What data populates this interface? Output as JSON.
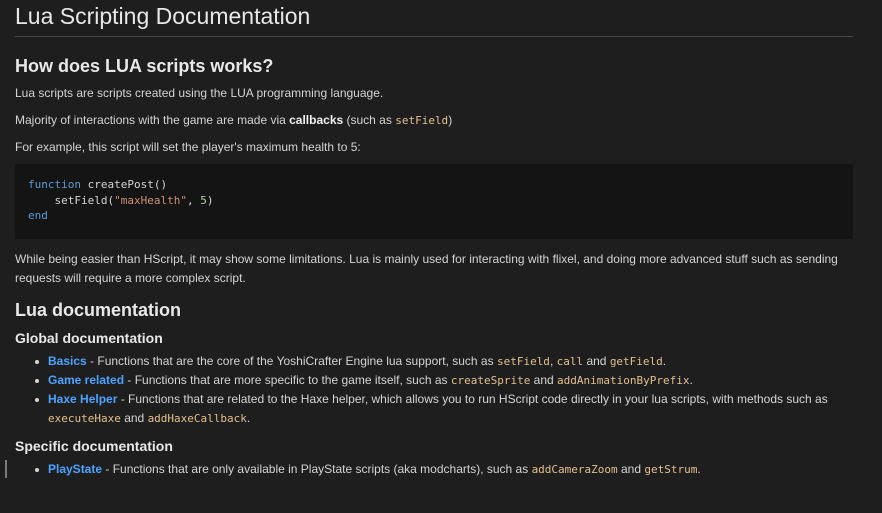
{
  "title": "Lua Scripting Documentation",
  "section1": {
    "heading": "How does LUA scripts works?",
    "p1": "Lua scripts are scripts created using the LUA programming language.",
    "p2_before": "Majority of interactions with the game are made via ",
    "p2_bold": "callbacks",
    "p2_mid": " (such as ",
    "p2_code": "setField",
    "p2_after": ")",
    "p3": "For example, this script will set the player's maximum health to 5:",
    "code": {
      "l1_kw": "function",
      "l1_rest": " createPost()",
      "l2_pre": "    setField(",
      "l2_str": "\"maxHealth\"",
      "l2_mid": ", ",
      "l2_num": "5",
      "l2_post": ")",
      "l3_kw": "end"
    },
    "p4": "While being easier than HScript, it may show some limitations. Lua is mainly used for interacting with flixel, and doing more advanced stuff such as sending requests will require a more complex script."
  },
  "section2": {
    "heading": "Lua documentation",
    "global_heading": "Global documentation",
    "global_items": [
      {
        "link": "Basics",
        "t1": " - Functions that are the core of the YoshiCrafter Engine lua support, such as ",
        "c1": "setField",
        "t2": ", ",
        "c2": "call",
        "t3": " and ",
        "c3": "getField",
        "t4": "."
      },
      {
        "link": "Game related",
        "t1": " - Functions that are more specific to the game itself, such as ",
        "c1": "createSprite",
        "t2": " and ",
        "c2": "addAnimationByPrefix",
        "t3": "."
      },
      {
        "link": "Haxe Helper",
        "t1": " - Functions that are related to the Haxe helper, which allows you to run HScript code directly in your lua scripts, with methods such as ",
        "c1": "executeHaxe",
        "t2": " and ",
        "c2": "addHaxeCallback",
        "t3": "."
      }
    ],
    "specific_heading": "Specific documentation",
    "specific_items": [
      {
        "link": "PlayState",
        "t1": " - Functions that are only available in PlayState scripts (aka modcharts), such as ",
        "c1": "addCameraZoom",
        "t2": " and ",
        "c2": "getStrum",
        "t3": "."
      }
    ]
  },
  "colors": {
    "background": "#1e1e1e",
    "link": "#4aa3ff",
    "inline_code": "#e2c08d",
    "code_block_bg": "#141414"
  }
}
